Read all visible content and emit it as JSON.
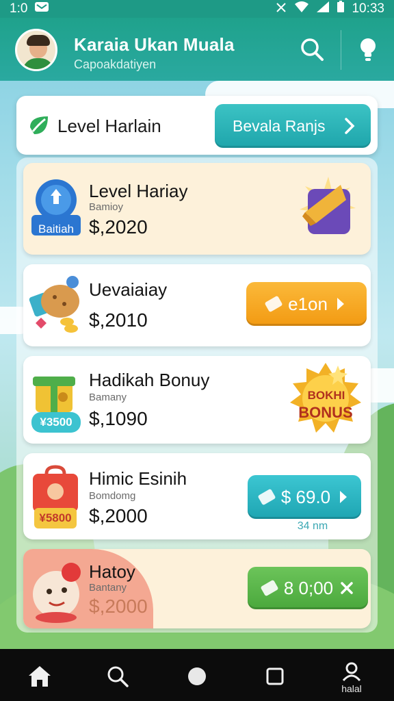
{
  "status_bar": {
    "time_left": "1:0",
    "time_right": "10:33"
  },
  "header": {
    "title": "Karaia Ukan Muala",
    "subtitle": "Capoakdatiyen"
  },
  "top_card": {
    "title": "Level Harlain",
    "button_label": "Bevala Ranjs"
  },
  "rows": [
    {
      "title": "Level Hariay",
      "subtitle": "Bamioy",
      "amount": "$,2020",
      "icon_tag": "Baitiah",
      "bg": "#fdf1da"
    },
    {
      "title": "Uevaiaiay",
      "subtitle": "",
      "amount": "$,2010",
      "button_label": "e1on",
      "button_color": "#f5a623"
    },
    {
      "title": "Hadikah Bonuy",
      "subtitle": "Bamany",
      "amount": "$,1090",
      "icon_tag": "¥3500",
      "badge_top": "BOKHI",
      "badge_bottom": "BONUS"
    },
    {
      "title": "Himic Esinih",
      "subtitle": "Bomdomg",
      "amount": "$,2000",
      "icon_tag": "¥5800",
      "button_label": "$ 69.0",
      "button_caption": "34 nm",
      "button_color": "#27b5c2"
    },
    {
      "title": "Hatoy",
      "subtitle": "Bantany",
      "amount": "$,2000",
      "button_label": "8 0;00",
      "button_color": "#59b74b"
    }
  ],
  "bottom_nav": {
    "profile_label": "halal"
  },
  "colors": {
    "primary": "#1fa28c",
    "accent_teal": "#27b5c2",
    "accent_orange": "#f5a623",
    "accent_green": "#59b74b"
  }
}
